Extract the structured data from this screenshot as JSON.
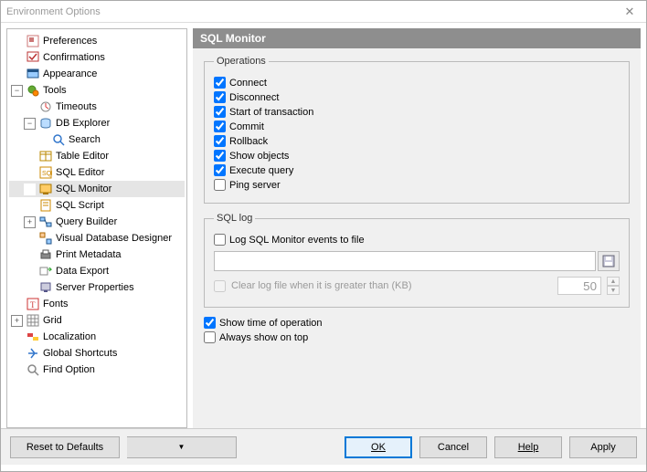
{
  "window": {
    "title": "Environment Options"
  },
  "tree": {
    "preferences": "Preferences",
    "confirmations": "Confirmations",
    "appearance": "Appearance",
    "tools": "Tools",
    "timeouts": "Timeouts",
    "db_explorer": "DB Explorer",
    "search": "Search",
    "table_editor": "Table Editor",
    "sql_editor": "SQL Editor",
    "sql_monitor": "SQL Monitor",
    "sql_script": "SQL Script",
    "query_builder": "Query Builder",
    "visual_db_designer": "Visual Database Designer",
    "print_metadata": "Print Metadata",
    "data_export": "Data Export",
    "server_properties": "Server Properties",
    "fonts": "Fonts",
    "grid": "Grid",
    "localization": "Localization",
    "global_shortcuts": "Global Shortcuts",
    "find_option": "Find Option"
  },
  "panel": {
    "header": "SQL Monitor",
    "operations_legend": "Operations",
    "ops": {
      "connect": {
        "label": "Connect",
        "checked": true
      },
      "disconnect": {
        "label": "Disconnect",
        "checked": true
      },
      "start_tx": {
        "label": "Start of transaction",
        "checked": true
      },
      "commit": {
        "label": "Commit",
        "checked": true
      },
      "rollback": {
        "label": "Rollback",
        "checked": true
      },
      "show_objects": {
        "label": "Show objects",
        "checked": true
      },
      "execute_query": {
        "label": "Execute query",
        "checked": true
      },
      "ping_server": {
        "label": "Ping server",
        "checked": false
      }
    },
    "sqllog_legend": "SQL log",
    "sqllog": {
      "log_to_file": {
        "label": "Log SQL Monitor events to file",
        "checked": false
      },
      "file_path": "",
      "clear_label": "Clear log file when it is greater than (KB)",
      "clear_checked": false,
      "kb_value": "50"
    },
    "show_time": {
      "label": "Show time of operation",
      "checked": true
    },
    "always_top": {
      "label": "Always show on top",
      "checked": false
    }
  },
  "footer": {
    "reset": "Reset to Defaults",
    "ok": "OK",
    "cancel": "Cancel",
    "help": "Help",
    "apply": "Apply"
  }
}
